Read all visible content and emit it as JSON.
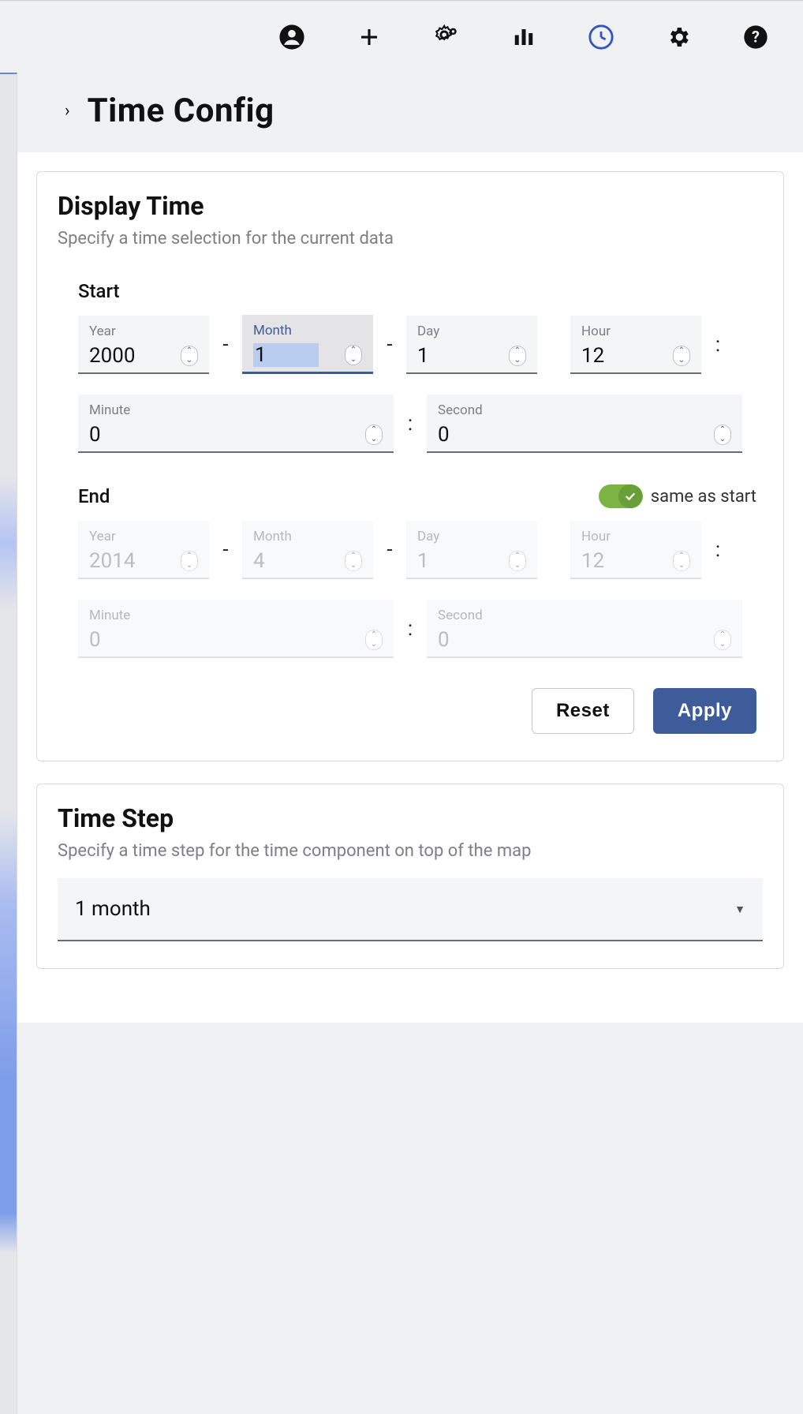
{
  "header": {
    "title": "Time Config"
  },
  "icons": {
    "account": "account-icon",
    "add": "plus-icon",
    "settings_alt": "cogs-icon",
    "chart": "bar-chart-icon",
    "clock": "clock-icon",
    "gear": "gear-icon",
    "help": "help-icon"
  },
  "displayTime": {
    "title": "Display Time",
    "subtitle": "Specify a time selection for the current data",
    "startLabel": "Start",
    "endLabel": "End",
    "sameAsStartLabel": "same as start",
    "sameAsStart": true,
    "labels": {
      "year": "Year",
      "month": "Month",
      "day": "Day",
      "hour": "Hour",
      "minute": "Minute",
      "second": "Second"
    },
    "start": {
      "year": "2000",
      "month": "1",
      "day": "1",
      "hour": "12",
      "minute": "0",
      "second": "0"
    },
    "end": {
      "year": "2014",
      "month": "4",
      "day": "1",
      "hour": "12",
      "minute": "0",
      "second": "0"
    },
    "reset": "Reset",
    "apply": "Apply"
  },
  "timeStep": {
    "title": "Time Step",
    "subtitle": "Specify a time step for the time component on top of the map",
    "value": "1 month"
  }
}
